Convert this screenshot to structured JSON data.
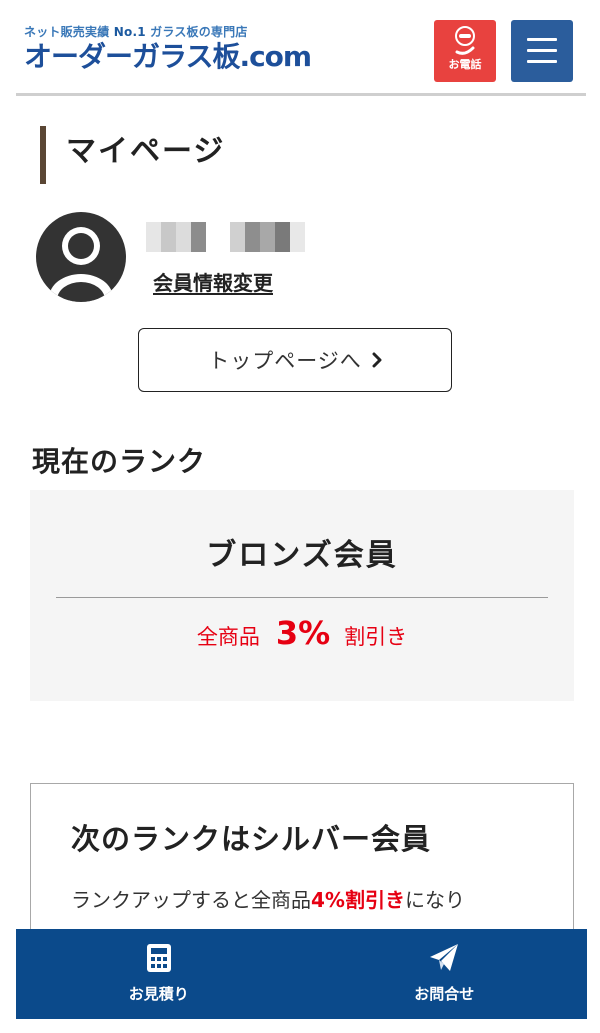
{
  "header": {
    "tagline_pre": "ネット販売実績 ",
    "tagline_highlight": "No.1",
    "tagline_post": " ガラス板の専門店",
    "logo_text": "オーダーガラス板.com",
    "phone_label": "お電話",
    "phone_icon": "phone-icon",
    "menu_icon": "hamburger-menu-icon"
  },
  "page": {
    "title": "マイページ"
  },
  "member": {
    "avatar_icon": "user-avatar-icon",
    "edit_link": "会員情報変更"
  },
  "top_button": {
    "label": "トップページへ",
    "icon": "chevron-right-icon"
  },
  "current_rank": {
    "heading": "現在のランク",
    "name": "ブロンズ会員",
    "discount_prefix": "全商品",
    "discount_value": "3%",
    "discount_suffix": "割引き"
  },
  "next_rank": {
    "title": "次のランクはシルバー会員",
    "desc_prefix": "ランクアップすると全商品",
    "desc_highlight": "4%割引き",
    "desc_suffix": "になり"
  },
  "bottom_nav": {
    "items": [
      {
        "label": "お見積り",
        "icon": "calculator-icon"
      },
      {
        "label": "お問合せ",
        "icon": "paper-plane-icon"
      }
    ]
  },
  "colors": {
    "phone_bg": "#e8423f",
    "menu_bg": "#2b5d9c",
    "nav_bg": "#0b4a8b",
    "accent_red": "#e60012",
    "title_bar": "#5a4634",
    "rank_bg": "#f5f5f5"
  }
}
